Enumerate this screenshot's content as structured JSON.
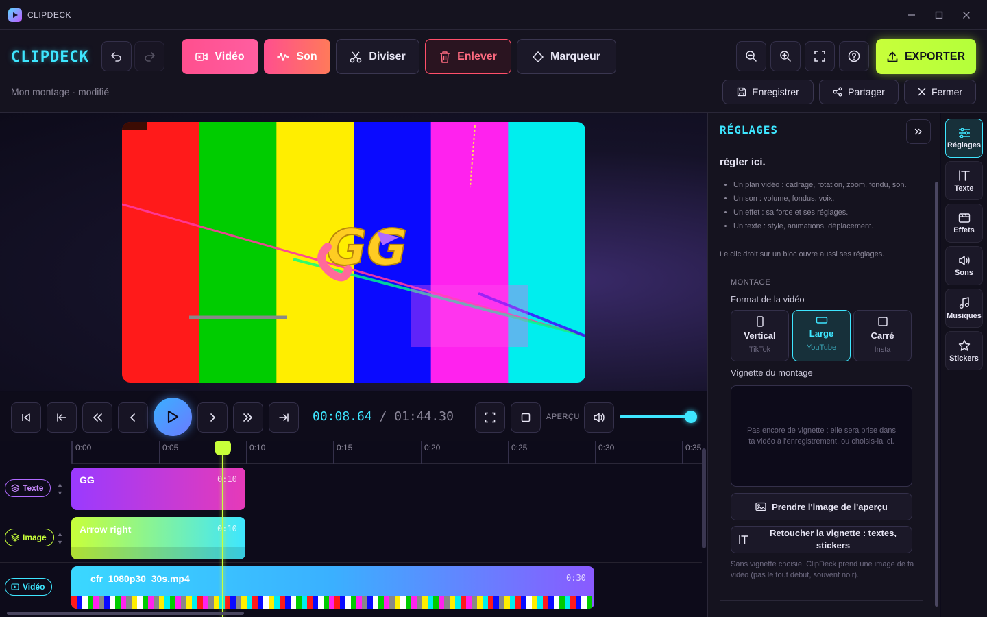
{
  "app": {
    "title": "CLIPDECK",
    "brand": "CLIPDECK"
  },
  "toolbar": {
    "video": "Vidéo",
    "sound": "Son",
    "split": "Diviser",
    "remove": "Enlever",
    "marker": "Marqueur",
    "export": "EXPORTER",
    "project_status": "Mon montage · modifié",
    "save": "Enregistrer",
    "share": "Partager",
    "close": "Fermer"
  },
  "colors": {
    "accent": "#3ee6ff",
    "lime": "#c8ff3a",
    "pink": "#ff4f8e"
  },
  "preview": {
    "overlay_text": "GG",
    "bars": [
      "#ff1a1a",
      "#00cc00",
      "#ffee00",
      "#0a0aff",
      "#ff22ee",
      "#00eeee"
    ]
  },
  "transport": {
    "current_time": "00:08.64",
    "separator": "/",
    "total_time": "01:44.30",
    "preview_label": "APERÇU",
    "volume": 1.0
  },
  "timeline": {
    "ticks": [
      "0:00",
      "0:05",
      "0:10",
      "0:15",
      "0:20",
      "0:25",
      "0:30",
      "0:35"
    ],
    "tracks": [
      {
        "label": "Texte",
        "clip": "GG",
        "duration": "0:10"
      },
      {
        "label": "Image",
        "clip": "Arrow right",
        "duration": "0:10"
      },
      {
        "label": "Vidéo",
        "clip": "cfr_1080p30_30s.mp4",
        "duration": "0:30"
      }
    ]
  },
  "panel": {
    "title": "RÉGLAGES",
    "help_title": "régler ici.",
    "help_items": [
      "Un plan vidéo : cadrage, rotation, zoom, fondu, son.",
      "Un son : volume, fondus, voix.",
      "Un effet : sa force et ses réglages.",
      "Un texte : style, animations, déplacement."
    ],
    "help_note": "Le clic droit sur un bloc ouvre aussi ses réglages.",
    "section": "MONTAGE",
    "format_label": "Format de la vidéo",
    "formats": [
      {
        "name": "Vertical",
        "sub": "TikTok"
      },
      {
        "name": "Large",
        "sub": "YouTube"
      },
      {
        "name": "Carré",
        "sub": "Insta"
      }
    ],
    "thumb_label": "Vignette du montage",
    "thumb_empty": "Pas encore de vignette : elle sera prise dans ta vidéo à l'enregistrement, ou choisis-la ici.",
    "take_frame": "Prendre l'image de l'aperçu",
    "retouch": "Retoucher la vignette : textes, stickers",
    "foot_note": "Sans vignette choisie, ClipDeck prend une image de ta vidéo (pas le tout début, souvent noir)."
  },
  "rail": [
    "Réglages",
    "Texte",
    "Effets",
    "Sons",
    "Musiques",
    "Stickers"
  ]
}
